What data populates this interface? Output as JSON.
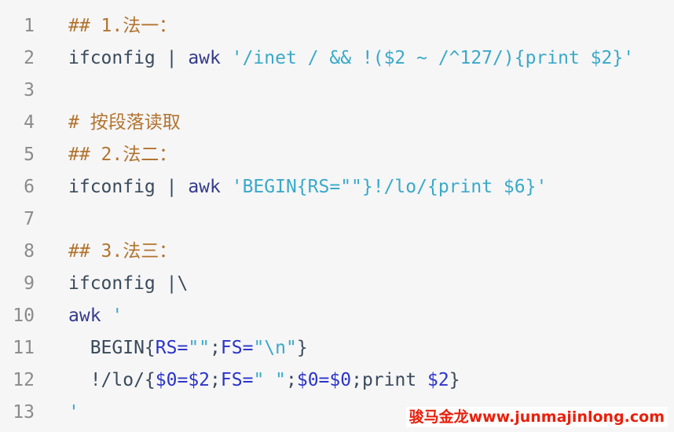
{
  "code": {
    "line_numbers": [
      "1",
      "2",
      "3",
      "4",
      "5",
      "6",
      "7",
      "8",
      "9",
      "10",
      "11",
      "12",
      "13"
    ],
    "lines": [
      [
        {
          "t": "## 1.法一：",
          "c": "comment"
        }
      ],
      [
        {
          "t": "ifconfig | ",
          "c": "plain"
        },
        {
          "t": "awk",
          "c": "kw"
        },
        {
          "t": " '/inet / && !($2 ~ /^127/){print $2}'",
          "c": "str"
        }
      ],
      [],
      [
        {
          "t": "# 按段落读取",
          "c": "comment"
        }
      ],
      [
        {
          "t": "## 2.法二：",
          "c": "comment"
        }
      ],
      [
        {
          "t": "ifconfig | ",
          "c": "plain"
        },
        {
          "t": "awk",
          "c": "kw"
        },
        {
          "t": " 'BEGIN{RS=\"\"}!/lo/{print $6}'",
          "c": "str"
        }
      ],
      [],
      [
        {
          "t": "## 3.法三：",
          "c": "comment"
        }
      ],
      [
        {
          "t": "ifconfig |\\",
          "c": "plain"
        }
      ],
      [
        {
          "t": "awk",
          "c": "kw"
        },
        {
          "t": " '",
          "c": "str"
        }
      ],
      [
        {
          "t": "  BEGIN{",
          "c": "plain"
        },
        {
          "t": "RS=",
          "c": "var"
        },
        {
          "t": "\"\"",
          "c": "str"
        },
        {
          "t": ";",
          "c": "plain"
        },
        {
          "t": "FS=",
          "c": "var"
        },
        {
          "t": "\"\\n\"",
          "c": "str"
        },
        {
          "t": "}",
          "c": "plain"
        }
      ],
      [
        {
          "t": "  !/lo/{",
          "c": "plain"
        },
        {
          "t": "$0=$2",
          "c": "var"
        },
        {
          "t": ";",
          "c": "plain"
        },
        {
          "t": "FS=",
          "c": "var"
        },
        {
          "t": "\" \"",
          "c": "str"
        },
        {
          "t": ";",
          "c": "plain"
        },
        {
          "t": "$0=$0",
          "c": "var"
        },
        {
          "t": ";print ",
          "c": "plain"
        },
        {
          "t": "$2",
          "c": "var"
        },
        {
          "t": "}",
          "c": "plain"
        }
      ],
      [
        {
          "t": "'",
          "c": "str"
        }
      ]
    ]
  },
  "colors": {
    "comment": "#b1742f",
    "plain": "#3a4a5a",
    "keyword": "#353a8c",
    "string": "#3aa9c9",
    "variable": "#2b34c9",
    "line_number": "#8b8b8b",
    "background": "#f6f6f7",
    "watermark": "#e8200c"
  },
  "watermark": {
    "text": "骏马金龙www.junmajinlong.com"
  }
}
